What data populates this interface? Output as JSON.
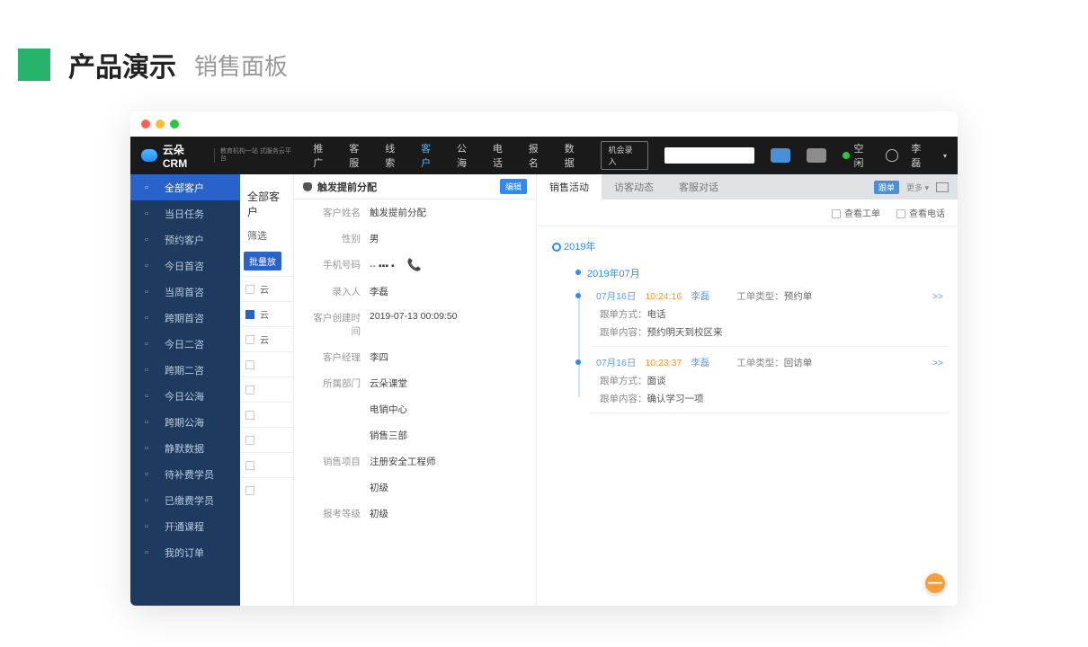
{
  "page": {
    "title_main": "产品演示",
    "title_sub": "销售面板"
  },
  "topnav": {
    "brand": "云朵CRM",
    "brand_sub": "教育机构一站\n式服务云平台",
    "items": [
      "推广",
      "客服",
      "线索",
      "客户",
      "公海",
      "电话",
      "报名",
      "数据"
    ],
    "active_index": 3,
    "action_btn": "机会录入",
    "status_text": "空闲",
    "user_name": "李磊"
  },
  "sidebar": {
    "items": [
      {
        "label": "全部客户",
        "active": true
      },
      {
        "label": "当日任务"
      },
      {
        "label": "预约客户"
      },
      {
        "label": "今日首咨"
      },
      {
        "label": "当周首咨"
      },
      {
        "label": "跨期首咨"
      },
      {
        "label": "今日二咨"
      },
      {
        "label": "跨期二咨"
      },
      {
        "label": "今日公海"
      },
      {
        "label": "跨期公海"
      },
      {
        "label": "静默数据"
      },
      {
        "label": "待补费学员"
      },
      {
        "label": "已缴费学员"
      },
      {
        "label": "开通课程"
      },
      {
        "label": "我的订单"
      }
    ]
  },
  "midcol": {
    "title": "全部客户",
    "filter_label": "筛选",
    "batch_chip": "批量放",
    "rows": [
      "云",
      "云",
      "云",
      "",
      "",
      "",
      "",
      "",
      ""
    ]
  },
  "detail": {
    "header_name": "触发提前分配",
    "edit_btn": "编辑",
    "fields": [
      {
        "label": "客户姓名",
        "value": "触发提前分配"
      },
      {
        "label": "性别",
        "value": "男"
      },
      {
        "label": "手机号码",
        "value": "-- ▪▪▪ ▪",
        "phone": true
      },
      {
        "label": "录入人",
        "value": "李磊"
      },
      {
        "label": "客户创建时间",
        "value": "2019-07-13 00:09:50"
      },
      {
        "label": "客户经理",
        "value": "李四"
      },
      {
        "label": "所属部门",
        "value": "云朵课堂"
      },
      {
        "label": "",
        "value": "电销中心"
      },
      {
        "label": "",
        "value": "销售三部"
      },
      {
        "label": "销售项目",
        "value": "注册安全工程师"
      },
      {
        "label": "",
        "value": "初级"
      },
      {
        "label": "报考等级",
        "value": "初级"
      }
    ]
  },
  "activity": {
    "tabs": [
      "销售活动",
      "访客动态",
      "客服对话"
    ],
    "active_tab": 0,
    "right_tag": "跟单",
    "right_more": "更多 ▾",
    "filter_checks": [
      {
        "label": "查看工单"
      },
      {
        "label": "查看电话"
      }
    ],
    "year": "2019年",
    "month": "2019年07月",
    "events": [
      {
        "date": "07月16日",
        "time": "10:24:16",
        "user": "李磊",
        "type_label": "工单类型：",
        "type_value": "预约单",
        "more": ">>",
        "rows": [
          {
            "label": "跟单方式：",
            "value": "电话"
          },
          {
            "label": "跟单内容：",
            "value": "预约明天到校区来"
          }
        ]
      },
      {
        "date": "07月16日",
        "time": "10:23:37",
        "user": "李磊",
        "type_label": "工单类型：",
        "type_value": "回访单",
        "more": ">>",
        "rows": [
          {
            "label": "跟单方式：",
            "value": "面谈"
          },
          {
            "label": "跟单内容：",
            "value": "确认学习一项"
          }
        ]
      }
    ]
  },
  "float_btn": "—"
}
